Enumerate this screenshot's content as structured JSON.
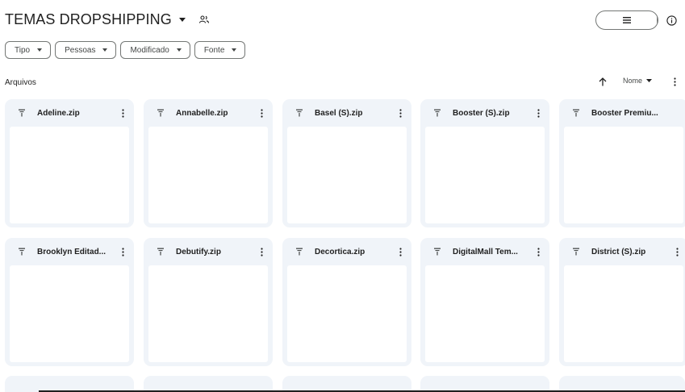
{
  "header": {
    "title": "TEMAS DROPSHIPPING"
  },
  "filters": [
    {
      "label": "Tipo"
    },
    {
      "label": "Pessoas"
    },
    {
      "label": "Modificado"
    },
    {
      "label": "Fonte"
    }
  ],
  "section": {
    "label": "Arquivos"
  },
  "sort": {
    "label": "Nome",
    "direction": "ascending"
  },
  "view": {
    "mode": "grid"
  },
  "files": [
    {
      "name": "Adeline.zip"
    },
    {
      "name": "Annabelle.zip"
    },
    {
      "name": "Basel (S).zip"
    },
    {
      "name": "Booster (S).zip"
    },
    {
      "name": "Booster Premiu..."
    },
    {
      "name": "Brooklyn Editad..."
    },
    {
      "name": "Debutify.zip"
    },
    {
      "name": "Decortica.zip"
    },
    {
      "name": "DigitalMall Tem..."
    },
    {
      "name": "District (S).zip"
    }
  ],
  "colors": {
    "selected_toggle": "#c2e7ff",
    "card_bg": "#f0f4f9",
    "text": "#1f1f1f"
  }
}
